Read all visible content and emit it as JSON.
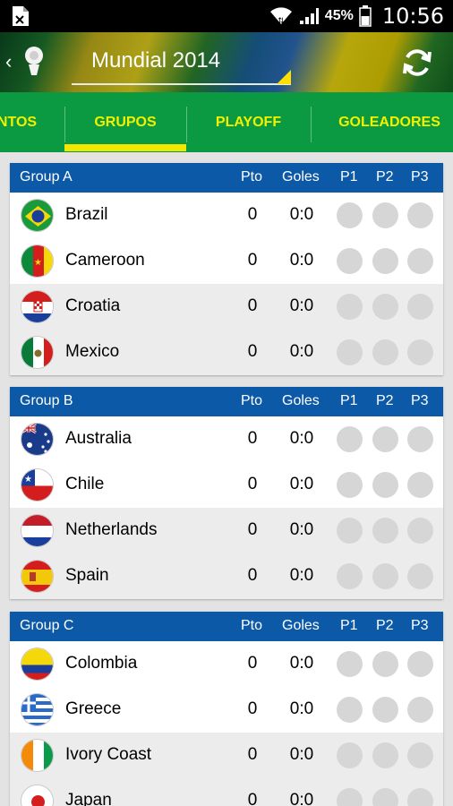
{
  "statusbar": {
    "battery": "45%",
    "time": "10:56"
  },
  "app": {
    "title": "Mundial 2014"
  },
  "tabs": [
    {
      "label": "NTOS",
      "active": false
    },
    {
      "label": "GRUPOS",
      "active": true
    },
    {
      "label": "PLAYOFF",
      "active": false
    },
    {
      "label": "GOLEADORES",
      "active": false
    }
  ],
  "columns": {
    "pto": "Pto",
    "goles": "Goles",
    "p1": "P1",
    "p2": "P2",
    "p3": "P3"
  },
  "groups": [
    {
      "name": "Group A",
      "teams": [
        {
          "name": "Brazil",
          "flag": "brazil-flag-icon",
          "pto": "0",
          "goles": "0:0"
        },
        {
          "name": "Cameroon",
          "flag": "cameroon-flag-icon",
          "pto": "0",
          "goles": "0:0"
        },
        {
          "name": "Croatia",
          "flag": "croatia-flag-icon",
          "pto": "0",
          "goles": "0:0"
        },
        {
          "name": "Mexico",
          "flag": "mexico-flag-icon",
          "pto": "0",
          "goles": "0:0"
        }
      ]
    },
    {
      "name": "Group B",
      "teams": [
        {
          "name": "Australia",
          "flag": "australia-flag-icon",
          "pto": "0",
          "goles": "0:0"
        },
        {
          "name": "Chile",
          "flag": "chile-flag-icon",
          "pto": "0",
          "goles": "0:0"
        },
        {
          "name": "Netherlands",
          "flag": "netherlands-flag-icon",
          "pto": "0",
          "goles": "0:0"
        },
        {
          "name": "Spain",
          "flag": "spain-flag-icon",
          "pto": "0",
          "goles": "0:0"
        }
      ]
    },
    {
      "name": "Group C",
      "teams": [
        {
          "name": "Colombia",
          "flag": "colombia-flag-icon",
          "pto": "0",
          "goles": "0:0"
        },
        {
          "name": "Greece",
          "flag": "greece-flag-icon",
          "pto": "0",
          "goles": "0:0"
        },
        {
          "name": "Ivory Coast",
          "flag": "ivory-coast-flag-icon",
          "pto": "0",
          "goles": "0:0"
        },
        {
          "name": "Japan",
          "flag": "japan-flag-icon",
          "pto": "0",
          "goles": "0:0"
        }
      ]
    }
  ],
  "colors": {
    "tab_bg": "#0b9a41",
    "tab_text": "#f3f000",
    "header_blue": "#0c59a8",
    "dot_grey": "#d6d6d6"
  }
}
